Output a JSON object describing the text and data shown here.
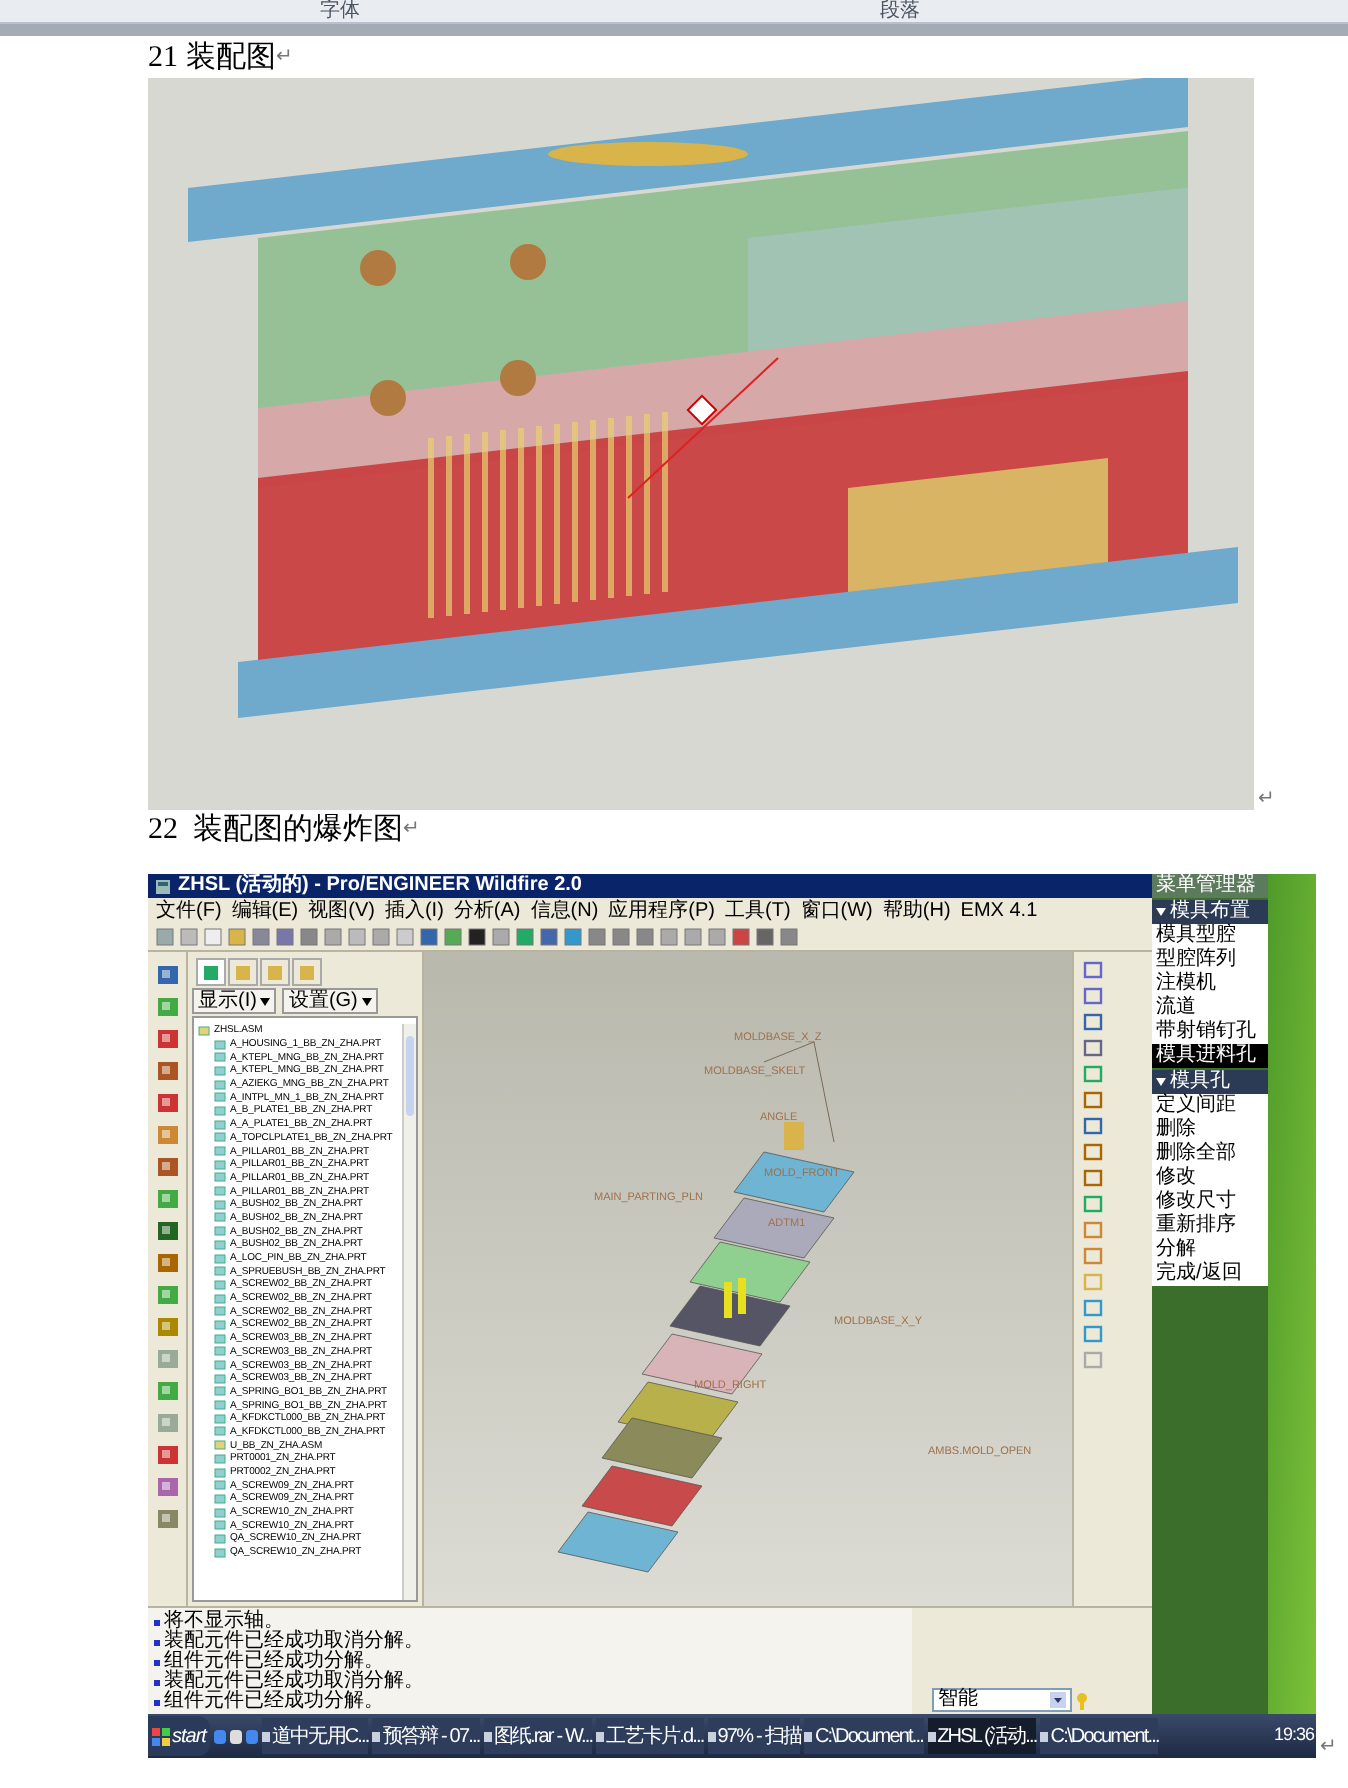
{
  "ribbon": {
    "groups": [
      "字体",
      "段落"
    ]
  },
  "paragraphs": [
    {
      "kind": "heading",
      "text": "21 装配图",
      "mark": "↵"
    },
    {
      "kind": "render",
      "mark": "↵"
    },
    {
      "kind": "heading",
      "text": "22  装配图的爆炸图",
      "mark": "↵"
    },
    {
      "kind": "screenshot",
      "mark": "↵"
    }
  ],
  "screenshot": {
    "title": "ZHSL (活动的) - Pro/ENGINEER Wildfire 2.0",
    "menu": [
      "文件(F)",
      "编辑(E)",
      "视图(V)",
      "插入(I)",
      "分析(A)",
      "信息(N)",
      "应用程序(P)",
      "工具(T)",
      "窗口(W)",
      "帮助(H)",
      "EMX 4.1"
    ],
    "navigator_tabs": [
      {
        "selected": true
      },
      {
        "selected": false
      },
      {
        "selected": false
      },
      {
        "selected": false
      }
    ],
    "tree_buttons": [
      "显示(I)",
      "设置(G)"
    ],
    "tree": [
      {
        "label": "ZHSL.ASM",
        "kind": "assembly",
        "children": [
          {
            "label": "A_HOUSING_1_BB_ZN_ZHA.PRT",
            "kind": "part"
          },
          {
            "label": "A_KTEPL_MNG_BB_ZN_ZHA.PRT",
            "kind": "part"
          },
          {
            "label": "A_KTEPL_MNG_BB_ZN_ZHA.PRT",
            "kind": "part"
          },
          {
            "label": "A_AZIEKG_MNG_BB_ZN_ZHA.PRT",
            "kind": "part"
          },
          {
            "label": "A_INTPL_MN_1_BB_ZN_ZHA.PRT",
            "kind": "part"
          },
          {
            "label": "A_B_PLATE1_BB_ZN_ZHA.PRT",
            "kind": "part"
          },
          {
            "label": "A_A_PLATE1_BB_ZN_ZHA.PRT",
            "kind": "part"
          },
          {
            "label": "A_TOPCLPLATE1_BB_ZN_ZHA.PRT",
            "kind": "part"
          },
          {
            "label": "A_PILLAR01_BB_ZN_ZHA.PRT",
            "kind": "part"
          },
          {
            "label": "A_PILLAR01_BB_ZN_ZHA.PRT",
            "kind": "part"
          },
          {
            "label": "A_PILLAR01_BB_ZN_ZHA.PRT",
            "kind": "part"
          },
          {
            "label": "A_PILLAR01_BB_ZN_ZHA.PRT",
            "kind": "part"
          },
          {
            "label": "A_BUSH02_BB_ZN_ZHA.PRT",
            "kind": "part"
          },
          {
            "label": "A_BUSH02_BB_ZN_ZHA.PRT",
            "kind": "part"
          },
          {
            "label": "A_BUSH02_BB_ZN_ZHA.PRT",
            "kind": "part"
          },
          {
            "label": "A_BUSH02_BB_ZN_ZHA.PRT",
            "kind": "part"
          },
          {
            "label": "A_LOC_PIN_BB_ZN_ZHA.PRT",
            "kind": "part"
          },
          {
            "label": "A_SPRUEBUSH_BB_ZN_ZHA.PRT",
            "kind": "part"
          },
          {
            "label": "A_SCREW02_BB_ZN_ZHA.PRT",
            "kind": "part"
          },
          {
            "label": "A_SCREW02_BB_ZN_ZHA.PRT",
            "kind": "part"
          },
          {
            "label": "A_SCREW02_BB_ZN_ZHA.PRT",
            "kind": "part"
          },
          {
            "label": "A_SCREW02_BB_ZN_ZHA.PRT",
            "kind": "part"
          },
          {
            "label": "A_SCREW03_BB_ZN_ZHA.PRT",
            "kind": "part"
          },
          {
            "label": "A_SCREW03_BB_ZN_ZHA.PRT",
            "kind": "part"
          },
          {
            "label": "A_SCREW03_BB_ZN_ZHA.PRT",
            "kind": "part"
          },
          {
            "label": "A_SCREW03_BB_ZN_ZHA.PRT",
            "kind": "part"
          },
          {
            "label": "A_SPRING_BO1_BB_ZN_ZHA.PRT",
            "kind": "part"
          },
          {
            "label": "A_SPRING_BO1_BB_ZN_ZHA.PRT",
            "kind": "part"
          },
          {
            "label": "A_KFDKCTL000_BB_ZN_ZHA.PRT",
            "kind": "part"
          },
          {
            "label": "A_KFDKCTL000_BB_ZN_ZHA.PRT",
            "kind": "part"
          },
          {
            "label": "U_BB_ZN_ZHA.ASM",
            "kind": "assembly"
          },
          {
            "label": "PRT0001_ZN_ZHA.PRT",
            "kind": "part"
          },
          {
            "label": "PRT0002_ZN_ZHA.PRT",
            "kind": "part"
          },
          {
            "label": "A_SCREW09_ZN_ZHA.PRT",
            "kind": "part"
          },
          {
            "label": "A_SCREW09_ZN_ZHA.PRT",
            "kind": "part"
          },
          {
            "label": "A_SCREW10_ZN_ZHA.PRT",
            "kind": "part"
          },
          {
            "label": "A_SCREW10_ZN_ZHA.PRT",
            "kind": "part"
          },
          {
            "label": "QA_SCREW10_ZN_ZHA.PRT",
            "kind": "part"
          },
          {
            "label": "QA_SCREW10_ZN_ZHA.PRT",
            "kind": "part"
          }
        ]
      }
    ],
    "labels": [
      "MOLDBASE_X_Z",
      "MOLDBASE_SKELT",
      "ANGLE",
      "MOLD_FRONT",
      "MAIN_PARTING_PLN",
      "ADTM1",
      "MOLDBASE_X_Y",
      "MOLD_RIGHT",
      "AMBS.MOLD_OPEN"
    ],
    "menu_manager": {
      "title": "菜单管理器",
      "sections": [
        {
          "title": "模具布置",
          "items": [
            {
              "label": "模具型腔",
              "selected": false
            },
            {
              "label": "型腔阵列",
              "selected": false
            },
            {
              "label": "注模机",
              "selected": false
            },
            {
              "label": "流道",
              "selected": false
            },
            {
              "label": "带射销钉孔",
              "selected": false
            },
            {
              "label": "模具进料孔",
              "selected": true
            }
          ]
        },
        {
          "title": "模具孔",
          "items": [
            {
              "label": "定义间距",
              "selected": false
            },
            {
              "label": "删除",
              "selected": false
            },
            {
              "label": "删除全部",
              "selected": false
            },
            {
              "label": "修改",
              "selected": false
            },
            {
              "label": "修改尺寸",
              "selected": false
            },
            {
              "label": "重新排序",
              "selected": false
            },
            {
              "label": "分解",
              "selected": false
            },
            {
              "label": "完成/返回",
              "selected": false
            }
          ]
        }
      ]
    },
    "messages": [
      "将不显示轴。",
      "装配元件已经成功取消分解。",
      "组件元件已经成功分解。",
      "装配元件已经成功取消分解。",
      "组件元件已经成功分解。"
    ],
    "status_field": "智能",
    "taskbar": {
      "start": "start",
      "items": [
        {
          "label": "道中无用C...",
          "selected": false
        },
        {
          "label": "预答辩 - 07...",
          "selected": false
        },
        {
          "label": "图纸.rar - W...",
          "selected": false
        },
        {
          "label": "工艺卡片.d...",
          "selected": false
        },
        {
          "label": "97% - 扫描",
          "selected": false
        },
        {
          "label": "C:\\Document...",
          "selected": false
        },
        {
          "label": "ZHSL (活动...",
          "selected": true
        },
        {
          "label": "C:\\Document...",
          "selected": false
        }
      ],
      "clock": "19:36"
    }
  }
}
